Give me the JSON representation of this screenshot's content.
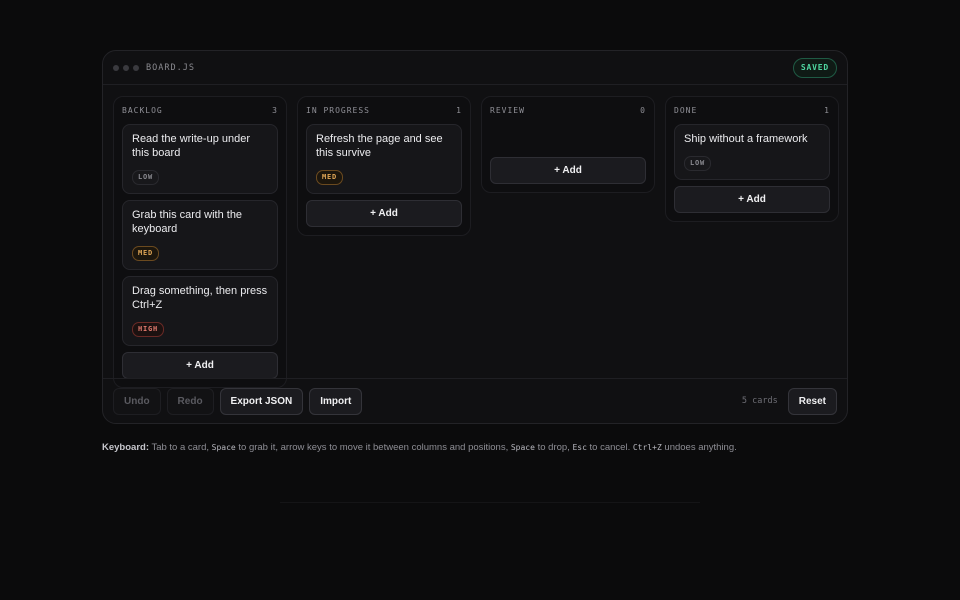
{
  "app": {
    "title": "BOARD.JS",
    "status": "SAVED"
  },
  "columns": [
    {
      "name": "BACKLOG",
      "count": "3",
      "cards": [
        {
          "title": "Read the write-up under this board",
          "priority": "LOW"
        },
        {
          "title": "Grab this card with the keyboard",
          "priority": "MED"
        },
        {
          "title": "Drag something, then press Ctrl+Z",
          "priority": "HIGH"
        }
      ],
      "add_label": "+ Add"
    },
    {
      "name": "IN PROGRESS",
      "count": "1",
      "cards": [
        {
          "title": "Refresh the page and see this survive",
          "priority": "MED"
        }
      ],
      "add_label": "+ Add"
    },
    {
      "name": "REVIEW",
      "count": "0",
      "cards": [],
      "add_label": "+ Add"
    },
    {
      "name": "DONE",
      "count": "1",
      "cards": [
        {
          "title": "Ship without a framework",
          "priority": "LOW"
        }
      ],
      "add_label": "+ Add"
    }
  ],
  "footer": {
    "undo": "Undo",
    "redo": "Redo",
    "export": "Export JSON",
    "import": "Import",
    "card_count": "5 cards",
    "reset": "Reset"
  },
  "help": {
    "label": "Keyboard:",
    "t1": " Tab to a card, ",
    "k1": "Space",
    "t2": " to grab it, arrow keys to move it between columns and positions, ",
    "k2": "Space",
    "t3": " to drop, ",
    "k3": "Esc",
    "t4": " to cancel. ",
    "k4": "Ctrl+Z",
    "t5": " undoes anything."
  },
  "colors": {
    "background": "#0b0b0c",
    "panel": "#101012",
    "saved_green": "#4fd6a0",
    "med_amber": "#e3a857",
    "high_red": "#e27a6e"
  }
}
